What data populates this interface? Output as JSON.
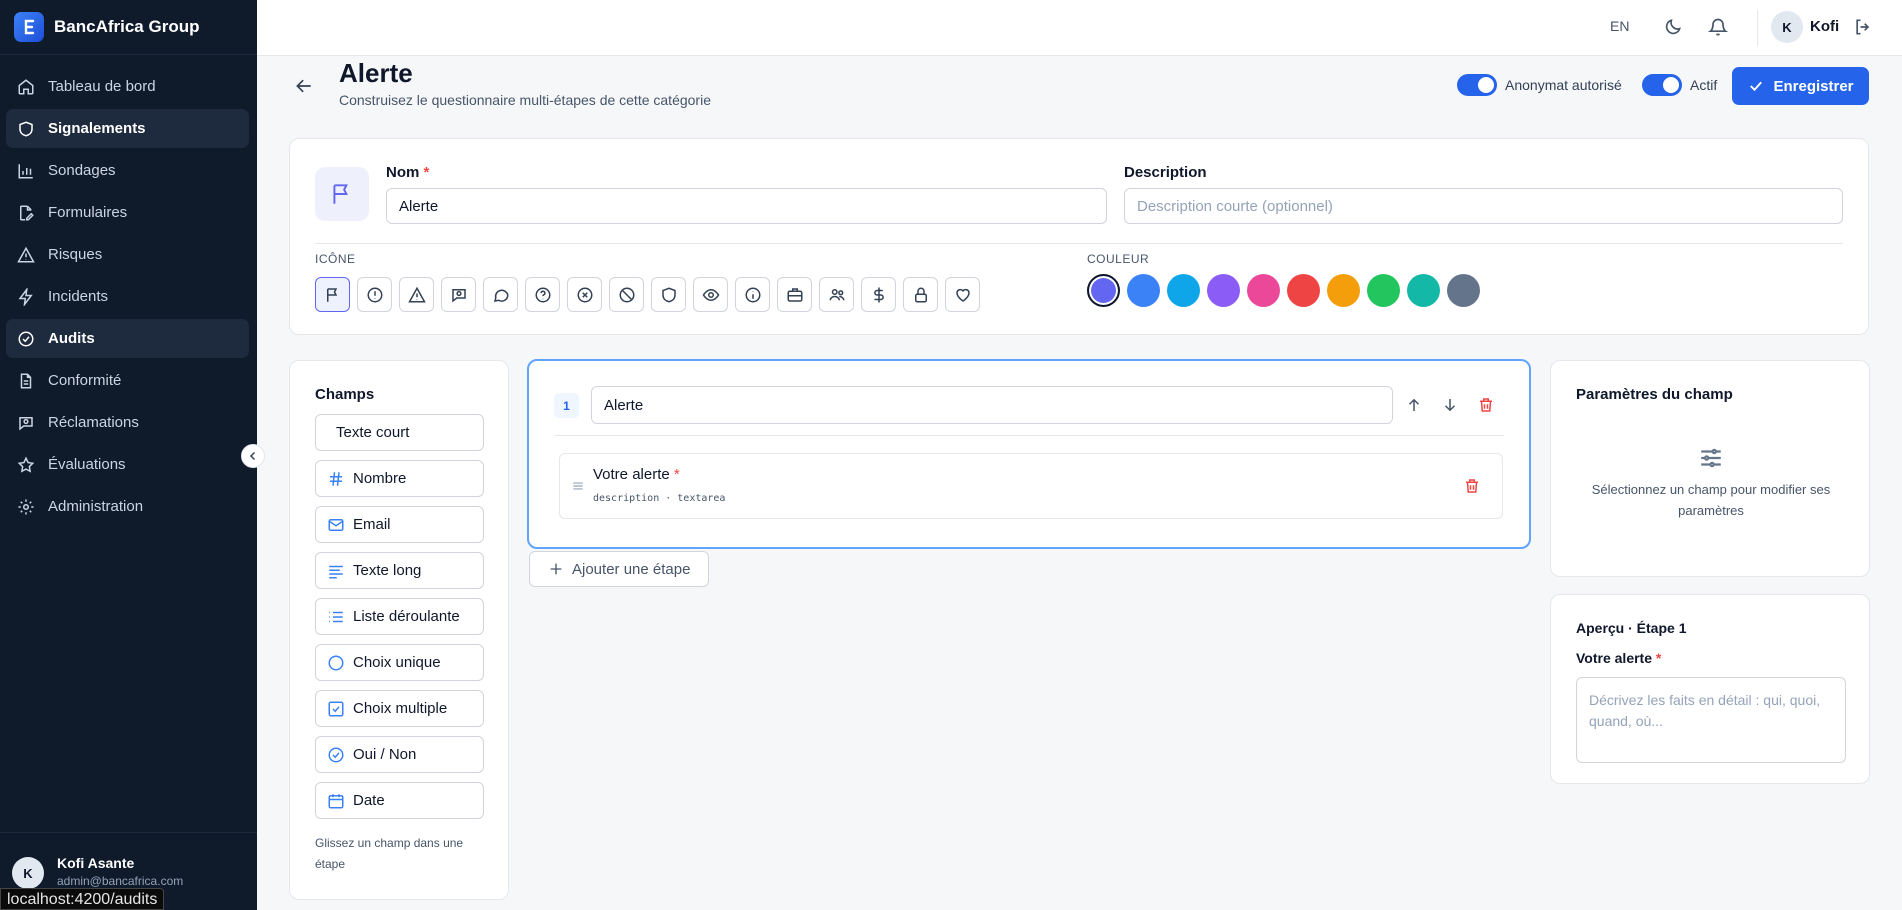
{
  "sidebar": {
    "brand": "BancAfrica Group",
    "items": [
      {
        "label": "Tableau de bord",
        "icon": "home-icon"
      },
      {
        "label": "Signalements",
        "icon": "shield-icon"
      },
      {
        "label": "Sondages",
        "icon": "bar-chart-icon"
      },
      {
        "label": "Formulaires",
        "icon": "file-edit-icon"
      },
      {
        "label": "Risques",
        "icon": "warning-triangle-icon"
      },
      {
        "label": "Incidents",
        "icon": "lightning-icon"
      },
      {
        "label": "Audits",
        "icon": "check-circle-icon"
      },
      {
        "label": "Conformité",
        "icon": "document-icon"
      },
      {
        "label": "Réclamations",
        "icon": "message-search-icon"
      },
      {
        "label": "Évaluations",
        "icon": "star-icon"
      },
      {
        "label": "Administration",
        "icon": "gear-icon"
      }
    ],
    "user": {
      "initial": "K",
      "name": "Kofi Asante",
      "email": "admin@bancafrica.com"
    },
    "url_tooltip": "localhost:4200/audits"
  },
  "topbar": {
    "lang": "EN",
    "user_initial": "K",
    "user_name": "Kofi"
  },
  "header": {
    "title": "Alerte",
    "subtitle": "Construisez le questionnaire multi-étapes de cette catégorie",
    "toggle_anon": "Anonymat autorisé",
    "toggle_active": "Actif",
    "save": "Enregistrer"
  },
  "form": {
    "name_label": "Nom",
    "required_mark": "*",
    "name_value": "Alerte",
    "desc_label": "Description",
    "desc_placeholder": "Description courte (optionnel)",
    "icon_label": "ICÔNE",
    "color_label": "COULEUR",
    "icons": [
      "flag-icon",
      "alert-circle-icon",
      "warning-triangle-icon",
      "message-alert-icon",
      "chat-bubble-icon",
      "help-circle-icon",
      "x-circle-icon",
      "ban-icon",
      "shield-icon",
      "eye-icon",
      "info-icon",
      "briefcase-icon",
      "users-icon",
      "dollar-icon",
      "lock-icon",
      "heart-icon"
    ],
    "colors": [
      "#6366f1",
      "#3b82f6",
      "#0ea5e9",
      "#8b5cf6",
      "#ec4899",
      "#ef4444",
      "#f59e0b",
      "#22c55e",
      "#14b8a6",
      "#64748b"
    ]
  },
  "fields_panel": {
    "title": "Champs",
    "items": [
      {
        "label": "Texte court",
        "icon": ""
      },
      {
        "label": "Nombre",
        "icon": "hash-icon"
      },
      {
        "label": "Email",
        "icon": "mail-icon"
      },
      {
        "label": "Texte long",
        "icon": "align-left-icon"
      },
      {
        "label": "Liste déroulante",
        "icon": "list-icon"
      },
      {
        "label": "Choix unique",
        "icon": "radio-circle-icon"
      },
      {
        "label": "Choix multiple",
        "icon": "checkbox-icon"
      },
      {
        "label": "Oui / Non",
        "icon": "check-circle-icon"
      },
      {
        "label": "Date",
        "icon": "calendar-icon"
      }
    ],
    "hint": "Glissez un champ dans une étape"
  },
  "step": {
    "number": "1",
    "title": "Alerte",
    "field_label": "Votre alerte",
    "field_meta": "description · textarea",
    "add_step": "Ajouter une étape"
  },
  "params": {
    "title": "Paramètres du champ",
    "empty_text": "Sélectionnez un champ pour modifier ses paramètres"
  },
  "preview": {
    "title": "Aperçu · Étape 1",
    "field_label": "Votre alerte",
    "placeholder": "Décrivez les faits en détail : qui, quoi, quand, où..."
  },
  "colors": {
    "accent": "#2563eb",
    "sidebar_bg": "#0f1a2b",
    "danger": "#ef4444"
  }
}
